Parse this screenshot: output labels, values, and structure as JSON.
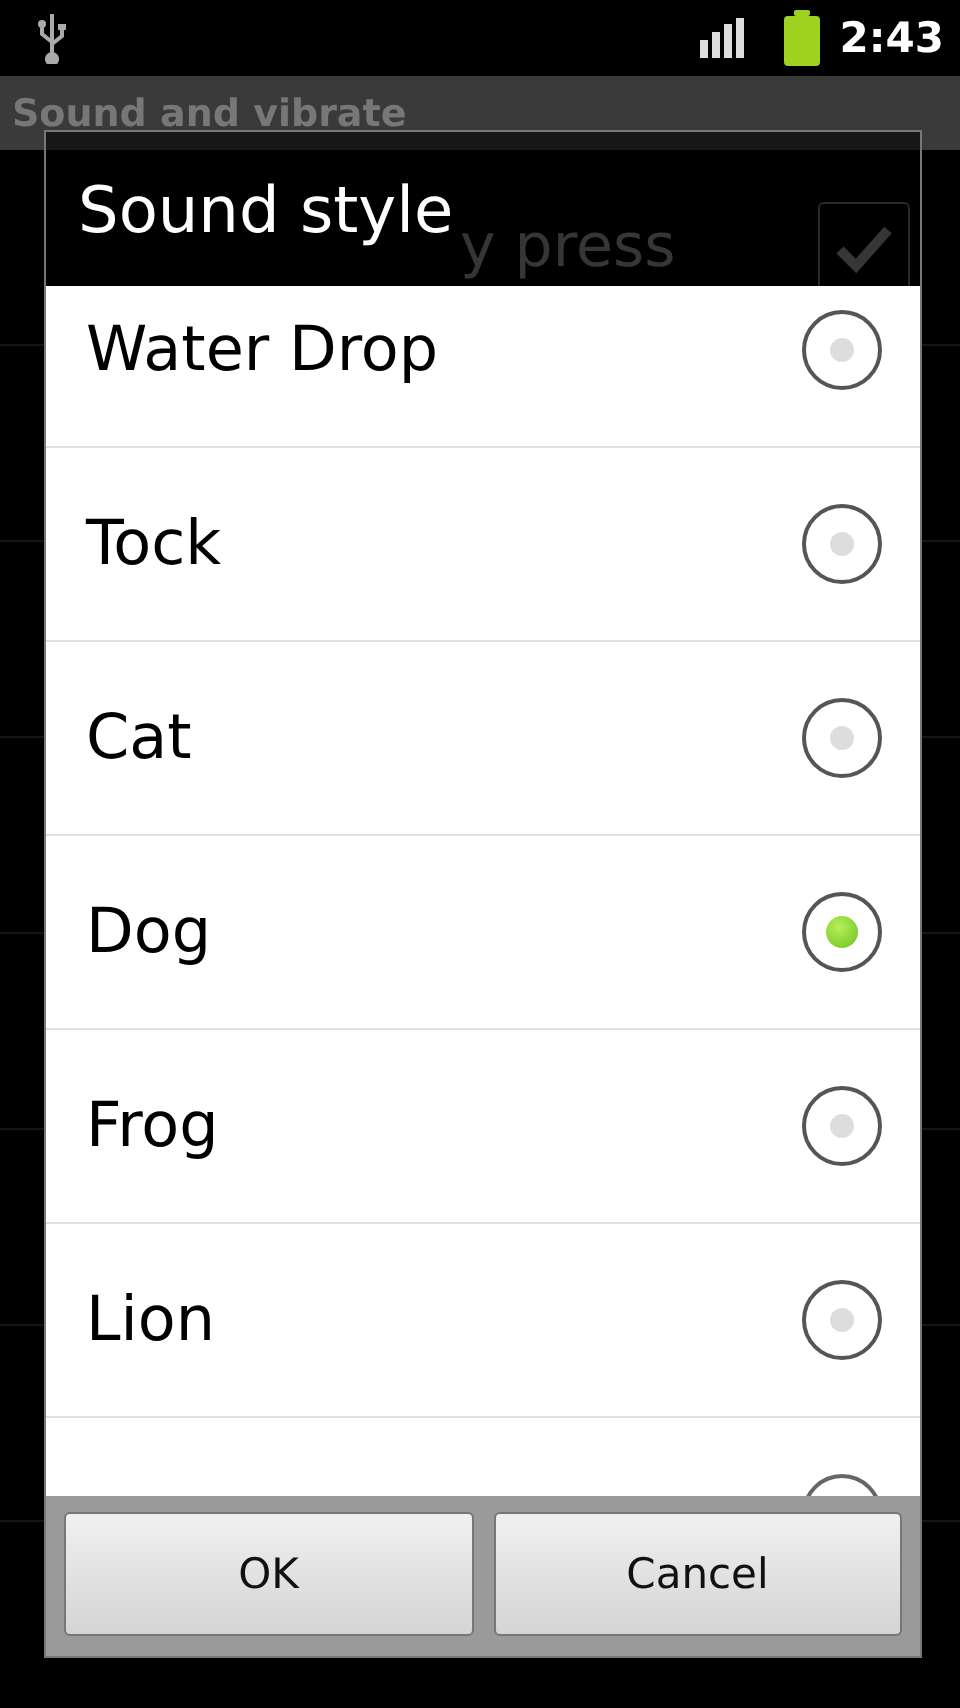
{
  "status_bar": {
    "time": "2:43"
  },
  "screen": {
    "title": "Sound and vibrate",
    "items": [
      {
        "label": "y press",
        "checked": true
      }
    ]
  },
  "dialog": {
    "title": "Sound style",
    "options": [
      {
        "label": "Water Drop",
        "selected": false
      },
      {
        "label": "Tock",
        "selected": false
      },
      {
        "label": "Cat",
        "selected": false
      },
      {
        "label": "Dog",
        "selected": true
      },
      {
        "label": "Frog",
        "selected": false
      },
      {
        "label": "Lion",
        "selected": false
      },
      {
        "kind": "cut_off"
      }
    ],
    "buttons": [
      "OK",
      "Cancel"
    ]
  }
}
